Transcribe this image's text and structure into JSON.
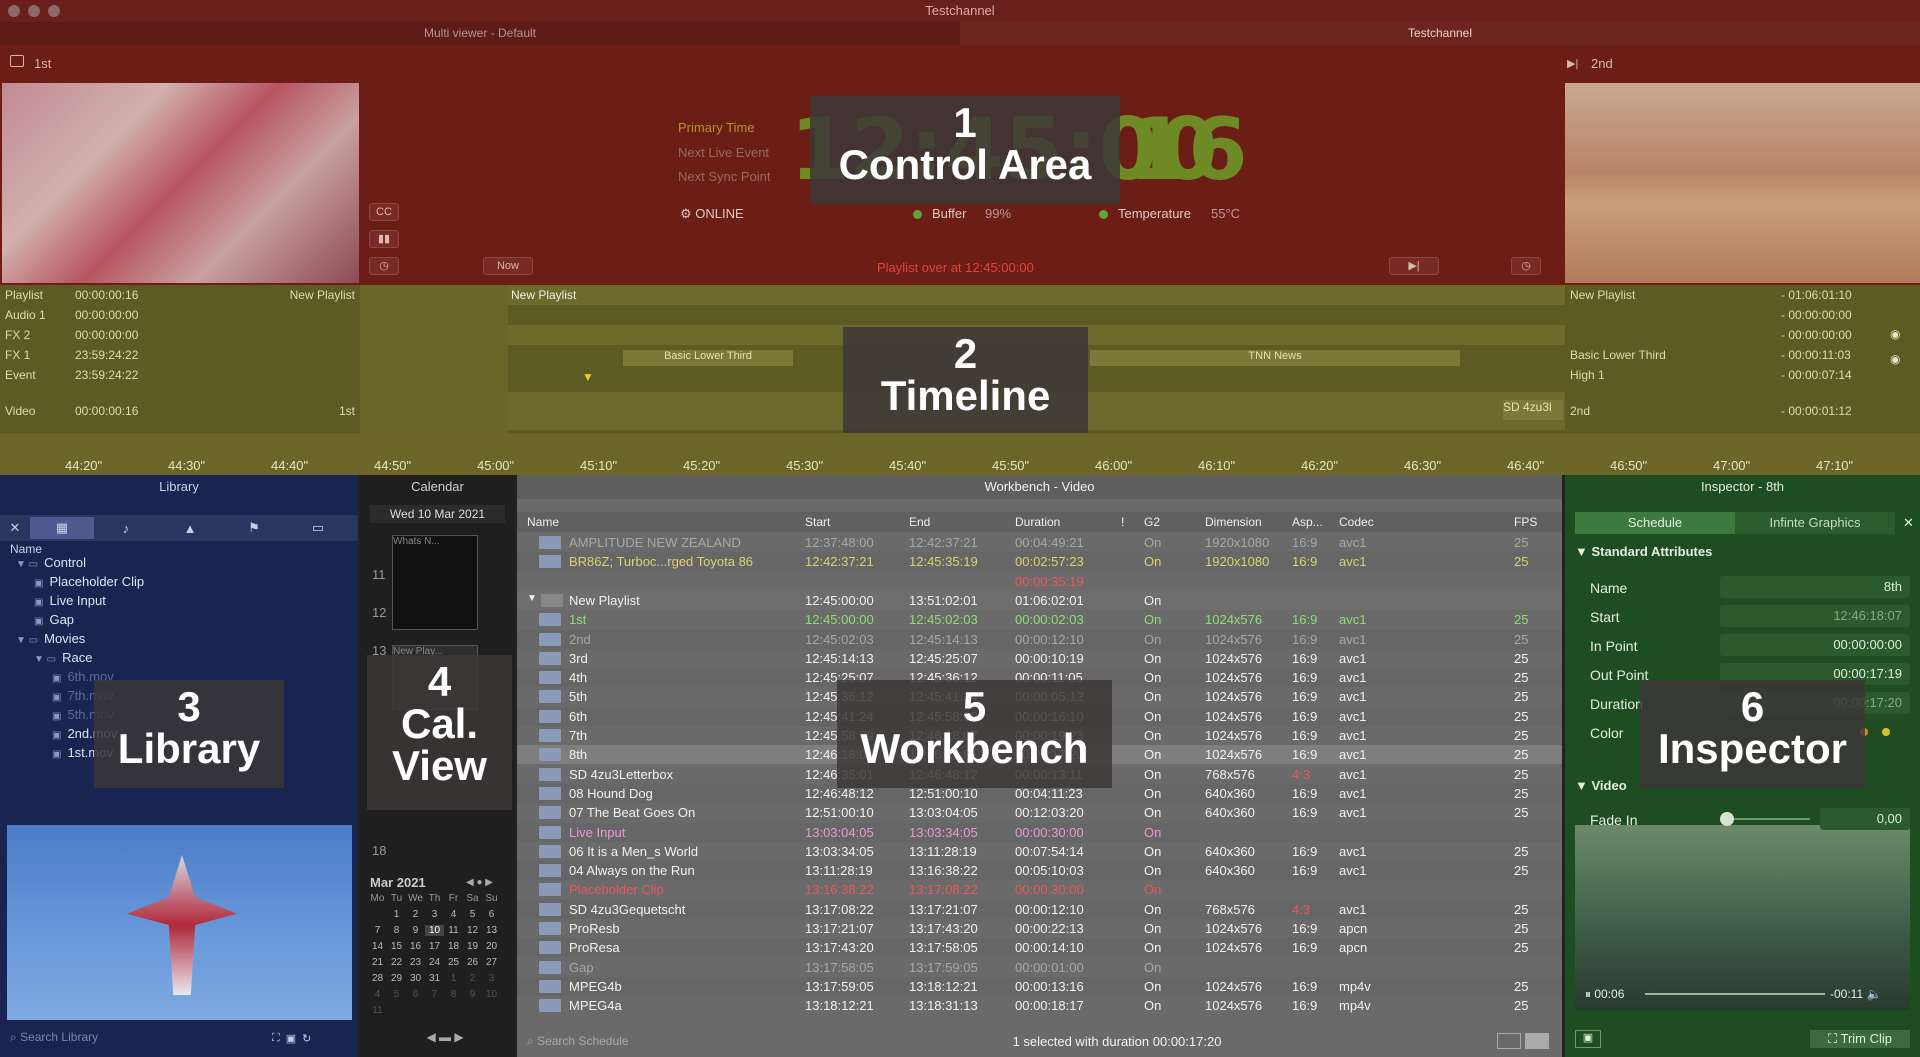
{
  "window": {
    "title": "Testchannel"
  },
  "tabs": [
    {
      "label": "Multi viewer - Default"
    },
    {
      "label": "Testchannel"
    }
  ],
  "control": {
    "left_label": "1st",
    "right_label": "2nd",
    "timecode_main": "12:45:00",
    "timecode_frames": "16",
    "primary_time": "Primary Time",
    "next_live_event": "Next Live Event",
    "next_sync_point": "Next Sync Point",
    "online": "ONLINE",
    "buffer_label": "Buffer",
    "buffer_value": "99%",
    "temp_label": "Temperature",
    "temp_value": "55°C",
    "now_button": "Now",
    "playlist_over": "Playlist over at 12:45:00:00",
    "cc_icon_label": "CC"
  },
  "timeline": {
    "left_rows": [
      {
        "name": "Playlist",
        "tc": "00:00:00:16",
        "extra": "New Playlist"
      },
      {
        "name": "Audio 1",
        "tc": "00:00:00:00",
        "extra": ""
      },
      {
        "name": "FX 2",
        "tc": "00:00:00:00",
        "extra": ""
      },
      {
        "name": "FX 1",
        "tc": "23:59:24:22",
        "extra": ""
      },
      {
        "name": "Event",
        "tc": "23:59:24:22",
        "extra": ""
      },
      {
        "name": "Video",
        "tc": "00:00:00:16",
        "extra": "1st"
      }
    ],
    "center_playlist": "New Playlist",
    "clip_lower_third": "Basic Lower Third",
    "clip_tnn": "TNN News",
    "clip_sd": "SD 4zu3l",
    "right_rows": [
      {
        "name": "New Playlist",
        "tc": "- 01:06:01:10"
      },
      {
        "name": "",
        "tc": "- 00:00:00:00"
      },
      {
        "name": "",
        "tc": "- 00:00:00:00"
      },
      {
        "name": "Basic Lower Third",
        "tc": "- 00:00:11:03"
      },
      {
        "name": "High 1",
        "tc": "- 00:00:07:14"
      },
      {
        "name": "2nd",
        "tc": "- 00:00:01:12"
      }
    ],
    "ruler": [
      "44:20\"",
      "44:30\"",
      "44:40\"",
      "44:50\"",
      "45:00\"",
      "45:10\"",
      "45:20\"",
      "45:30\"",
      "45:40\"",
      "45:50\"",
      "46:00\"",
      "46:10\"",
      "46:20\"",
      "46:30\"",
      "46:40\"",
      "46:50\"",
      "47:00\"",
      "47:10\""
    ]
  },
  "overlays": {
    "o1_num": "1",
    "o1_text": "Control Area",
    "o2_num": "2",
    "o2_text": "Timeline",
    "o3_num": "3",
    "o3_text": "Library",
    "o4_num": "4",
    "o4_text1": "Cal.",
    "o4_text2": "View",
    "o5_num": "5",
    "o5_text": "Workbench",
    "o6_num": "6",
    "o6_text": "Inspector"
  },
  "library": {
    "title": "Library",
    "col_name": "Name",
    "tree": [
      {
        "label": "Control",
        "level": 0
      },
      {
        "label": "Placeholder Clip",
        "level": 1
      },
      {
        "label": "Live Input",
        "level": 1
      },
      {
        "label": "Gap",
        "level": 1
      },
      {
        "label": "Movies",
        "level": 0
      },
      {
        "label": "Race",
        "level": 1
      },
      {
        "label": "6th.mov",
        "level": 2
      },
      {
        "label": "7th.mov",
        "level": 2
      },
      {
        "label": "5th.mov",
        "level": 2
      },
      {
        "label": "2nd.mov",
        "level": 2
      },
      {
        "label": "1st.mov",
        "level": 2
      }
    ],
    "search_placeholder": "Search Library"
  },
  "calendar": {
    "title": "Calendar",
    "date": "Wed 10 Mar 2021",
    "event1": "Whats N...",
    "event2": "New Play...",
    "hours": [
      "11",
      "12",
      "13",
      "18"
    ],
    "month": "Mar 2021",
    "weekdays": [
      "Mo",
      "Tu",
      "We",
      "Th",
      "Fr",
      "Sa",
      "Su"
    ],
    "days": [
      "",
      "1",
      "2",
      "3",
      "4",
      "5",
      "6",
      "7",
      "8",
      "9",
      "10",
      "11",
      "12",
      "13",
      "14",
      "15",
      "16",
      "17",
      "18",
      "19",
      "20",
      "21",
      "22",
      "23",
      "24",
      "25",
      "26",
      "27",
      "28",
      "29",
      "30",
      "31",
      "1",
      "2",
      "3",
      "4",
      "5",
      "6",
      "7",
      "8",
      "9",
      "10",
      "11"
    ]
  },
  "workbench": {
    "title": "Workbench - Video",
    "columns": [
      "Name",
      "Start",
      "End",
      "Duration",
      "!",
      "G2",
      "Dimension",
      "Asp...",
      "Codec",
      "FPS"
    ],
    "rows": [
      {
        "name": "AMPLITUDE NEW ZEALAND",
        "start": "12:37:48:00",
        "end": "12:42:37:21",
        "dur": "00:04:49:21",
        "g2": "On",
        "dim": "1920x1080",
        "asp": "16:9",
        "codec": "avc1",
        "fps": "25",
        "style": "dim"
      },
      {
        "name": "BR86Z; Turboc...rged Toyota 86",
        "start": "12:42:37:21",
        "end": "12:45:35:19",
        "dur": "00:02:57:23",
        "g2": "On",
        "dim": "1920x1080",
        "asp": "16:9",
        "codec": "avc1",
        "fps": "25",
        "style": "yellow"
      },
      {
        "name": "",
        "start": "",
        "end": "",
        "dur": "00:00:35:19",
        "g2": "",
        "dim": "",
        "asp": "",
        "codec": "",
        "fps": "",
        "style": "red"
      },
      {
        "name": "New Playlist",
        "start": "12:45:00:00",
        "end": "13:51:02:01",
        "dur": "01:06:02:01",
        "g2": "On",
        "dim": "",
        "asp": "",
        "codec": "",
        "fps": "",
        "style": "group"
      },
      {
        "name": "1st",
        "start": "12:45:00:00",
        "end": "12:45:02:03",
        "dur": "00:00:02:03",
        "g2": "On",
        "dim": "1024x576",
        "asp": "16:9",
        "codec": "avc1",
        "fps": "25",
        "style": "green"
      },
      {
        "name": "2nd",
        "start": "12:45:02:03",
        "end": "12:45:14:13",
        "dur": "00:00:12:10",
        "g2": "On",
        "dim": "1024x576",
        "asp": "16:9",
        "codec": "avc1",
        "fps": "25",
        "style": "dim"
      },
      {
        "name": "3rd",
        "start": "12:45:14:13",
        "end": "12:45:25:07",
        "dur": "00:00:10:19",
        "g2": "On",
        "dim": "1024x576",
        "asp": "16:9",
        "codec": "avc1",
        "fps": "25",
        "style": ""
      },
      {
        "name": "4th",
        "start": "12:45:25:07",
        "end": "12:45:36:12",
        "dur": "00:00:11:05",
        "g2": "On",
        "dim": "1024x576",
        "asp": "16:9",
        "codec": "avc1",
        "fps": "25",
        "style": ""
      },
      {
        "name": "5th",
        "start": "12:45:36:12",
        "end": "12:45:41:24",
        "dur": "00:00:05:12",
        "g2": "On",
        "dim": "1024x576",
        "asp": "16:9",
        "codec": "avc1",
        "fps": "25",
        "style": ""
      },
      {
        "name": "6th",
        "start": "12:45:41:24",
        "end": "12:45:58:09",
        "dur": "00:00:16:10",
        "g2": "On",
        "dim": "1024x576",
        "asp": "16:9",
        "codec": "avc1",
        "fps": "25",
        "style": ""
      },
      {
        "name": "7th",
        "start": "12:45:58:09",
        "end": "12:46:18:07",
        "dur": "00:00:19:23",
        "g2": "On",
        "dim": "1024x576",
        "asp": "16:9",
        "codec": "avc1",
        "fps": "25",
        "style": ""
      },
      {
        "name": "8th",
        "start": "12:46:18:07",
        "end": "12:46:35:01",
        "dur": "00:00:17:20",
        "g2": "On",
        "dim": "1024x576",
        "asp": "16:9",
        "codec": "avc1",
        "fps": "25",
        "style": "sel"
      },
      {
        "name": "SD 4zu3Letterbox",
        "start": "12:46:35:01",
        "end": "12:46:48:12",
        "dur": "00:00:13:11",
        "g2": "On",
        "dim": "768x576",
        "asp": "4:3",
        "codec": "avc1",
        "fps": "25",
        "style": "asp"
      },
      {
        "name": "08 Hound Dog",
        "start": "12:46:48:12",
        "end": "12:51:00:10",
        "dur": "00:04:11:23",
        "g2": "On",
        "dim": "640x360",
        "asp": "16:9",
        "codec": "avc1",
        "fps": "25",
        "style": ""
      },
      {
        "name": "07 The Beat Goes On",
        "start": "12:51:00:10",
        "end": "13:03:04:05",
        "dur": "00:12:03:20",
        "g2": "On",
        "dim": "640x360",
        "asp": "16:9",
        "codec": "avc1",
        "fps": "25",
        "style": ""
      },
      {
        "name": "Live Input",
        "start": "13:03:04:05",
        "end": "13:03:34:05",
        "dur": "00:00:30:00",
        "g2": "On",
        "dim": "",
        "asp": "",
        "codec": "",
        "fps": "",
        "style": "pink"
      },
      {
        "name": "06 It is a Men_s World",
        "start": "13:03:34:05",
        "end": "13:11:28:19",
        "dur": "00:07:54:14",
        "g2": "On",
        "dim": "640x360",
        "asp": "16:9",
        "codec": "avc1",
        "fps": "25",
        "style": ""
      },
      {
        "name": "04 Always on the Run",
        "start": "13:11:28:19",
        "end": "13:16:38:22",
        "dur": "00:05:10:03",
        "g2": "On",
        "dim": "640x360",
        "asp": "16:9",
        "codec": "avc1",
        "fps": "25",
        "style": ""
      },
      {
        "name": "Placeholder Clip",
        "start": "13:16:38:22",
        "end": "13:17:08:22",
        "dur": "00:00:30:00",
        "g2": "On",
        "dim": "",
        "asp": "",
        "codec": "",
        "fps": "",
        "style": "red"
      },
      {
        "name": "SD 4zu3Gequetscht",
        "start": "13:17:08:22",
        "end": "13:17:21:07",
        "dur": "00:00:12:10",
        "g2": "On",
        "dim": "768x576",
        "asp": "4:3",
        "codec": "avc1",
        "fps": "25",
        "style": "asp"
      },
      {
        "name": "ProResb",
        "start": "13:17:21:07",
        "end": "13:17:43:20",
        "dur": "00:00:22:13",
        "g2": "On",
        "dim": "1024x576",
        "asp": "16:9",
        "codec": "apcn",
        "fps": "25",
        "style": ""
      },
      {
        "name": "ProResa",
        "start": "13:17:43:20",
        "end": "13:17:58:05",
        "dur": "00:00:14:10",
        "g2": "On",
        "dim": "1024x576",
        "asp": "16:9",
        "codec": "apcn",
        "fps": "25",
        "style": ""
      },
      {
        "name": "Gap",
        "start": "13:17:58:05",
        "end": "13:17:59:05",
        "dur": "00:00:01:00",
        "g2": "On",
        "dim": "",
        "asp": "",
        "codec": "",
        "fps": "",
        "style": "dim"
      },
      {
        "name": "MPEG4b",
        "start": "13:17:59:05",
        "end": "13:18:12:21",
        "dur": "00:00:13:16",
        "g2": "On",
        "dim": "1024x576",
        "asp": "16:9",
        "codec": "mp4v",
        "fps": "25",
        "style": ""
      },
      {
        "name": "MPEG4a",
        "start": "13:18:12:21",
        "end": "13:18:31:13",
        "dur": "00:00:18:17",
        "g2": "On",
        "dim": "1024x576",
        "asp": "16:9",
        "codec": "mp4v",
        "fps": "25",
        "style": ""
      }
    ],
    "search_placeholder": "Search Schedule",
    "status": "1 selected with duration 00:00:17:20"
  },
  "inspector": {
    "title": "Inspector - 8th",
    "tab_schedule": "Schedule",
    "tab_graphics": "Infinte Graphics",
    "section": "Standard Attributes",
    "name_label": "Name",
    "name_value": "8th",
    "start_label": "Start",
    "start_value": "12:46:18:07",
    "in_label": "In Point",
    "in_value": "00:00:00:00",
    "out_label": "Out Point",
    "out_value": "00:00:17:19",
    "dur_label": "Duration",
    "dur_value": "00:00:17:20",
    "color_label": "Color",
    "video_section": "Video",
    "fade_label": "Fade In",
    "fade_value": "0,00",
    "play_elapsed": "00:06",
    "play_remaining": "-00:11",
    "trim_button": "Trim Clip"
  }
}
